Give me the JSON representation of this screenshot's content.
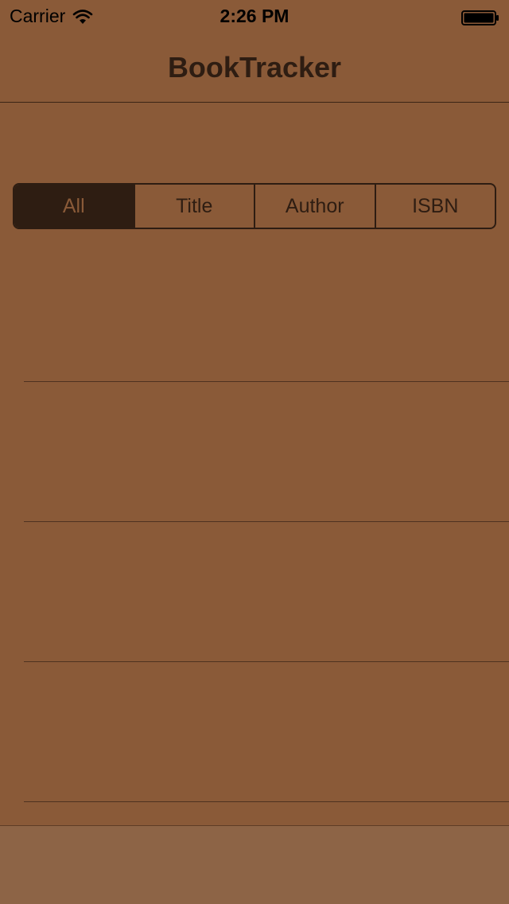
{
  "status_bar": {
    "carrier": "Carrier",
    "time": "2:26 PM",
    "wifi_icon": "wifi-icon",
    "battery_icon": "battery-icon"
  },
  "nav": {
    "title": "BookTracker"
  },
  "search_scope": {
    "segments": [
      "All",
      "Title",
      "Author",
      "ISBN"
    ],
    "selected": "All"
  },
  "table": {
    "rows": [
      "",
      "",
      "",
      ""
    ]
  },
  "colors": {
    "background": "#8a5a38",
    "dark": "#2e1d12",
    "toolbar": "#8d6446"
  }
}
